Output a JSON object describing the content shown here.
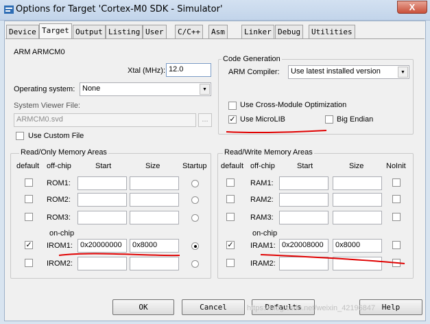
{
  "window": {
    "title": "Options for Target 'Cortex-M0 SDK - Simulator'",
    "close": "X"
  },
  "tabs": [
    "Device",
    "Target",
    "Output",
    "Listing",
    "User",
    "C/C++",
    "Asm",
    "Linker",
    "Debug",
    "Utilities"
  ],
  "active_tab": "Target",
  "device": {
    "name": "ARM ARMCM0",
    "xtal_label": "Xtal (MHz):",
    "xtal_value": "12.0",
    "os_label": "Operating system:",
    "os_value": "None",
    "svf_label": "System Viewer File:",
    "svf_value": "ARMCM0.svd",
    "browse": "...",
    "custom_file_label": "Use Custom File",
    "custom_file_checked": false
  },
  "code_gen": {
    "group": "Code Generation",
    "compiler_label": "ARM Compiler:",
    "compiler_value": "Use latest installed version",
    "cross_module": "Use Cross-Module Optimization",
    "cross_module_checked": false,
    "microlib": "Use MicroLIB",
    "microlib_checked": true,
    "big_endian": "Big Endian",
    "big_endian_checked": false
  },
  "ro_mem": {
    "group": "Read/Only Memory Areas",
    "headers": {
      "default": "default",
      "offchip": "off-chip",
      "start": "Start",
      "size": "Size",
      "extra": "Startup"
    },
    "onchip_label": "on-chip",
    "rows": [
      {
        "label": "ROM1:",
        "start": "",
        "size": "",
        "default": false,
        "extra_on": false
      },
      {
        "label": "ROM2:",
        "start": "",
        "size": "",
        "default": false,
        "extra_on": false
      },
      {
        "label": "ROM3:",
        "start": "",
        "size": "",
        "default": false,
        "extra_on": false
      },
      {
        "label": "IROM1:",
        "start": "0x20000000",
        "size": "0x8000",
        "default": true,
        "extra_on": true
      },
      {
        "label": "IROM2:",
        "start": "",
        "size": "",
        "default": false,
        "extra_on": false
      }
    ]
  },
  "rw_mem": {
    "group": "Read/Write Memory Areas",
    "headers": {
      "default": "default",
      "offchip": "off-chip",
      "start": "Start",
      "size": "Size",
      "extra": "NoInit"
    },
    "onchip_label": "on-chip",
    "rows": [
      {
        "label": "RAM1:",
        "start": "",
        "size": "",
        "default": false,
        "extra_on": false
      },
      {
        "label": "RAM2:",
        "start": "",
        "size": "",
        "default": false,
        "extra_on": false
      },
      {
        "label": "RAM3:",
        "start": "",
        "size": "",
        "default": false,
        "extra_on": false
      },
      {
        "label": "IRAM1:",
        "start": "0x20008000",
        "size": "0x8000",
        "default": true,
        "extra_on": false
      },
      {
        "label": "IRAM2:",
        "start": "",
        "size": "",
        "default": false,
        "extra_on": false
      }
    ]
  },
  "buttons": {
    "ok": "OK",
    "cancel": "Cancel",
    "defaults": "Defaults",
    "help": "Help"
  },
  "watermark": "https://blog.csdn.net/weixin_42196847",
  "colors": {
    "annotation": "#e00000",
    "titlebar": "#c9dbef",
    "close": "#c9503a"
  }
}
